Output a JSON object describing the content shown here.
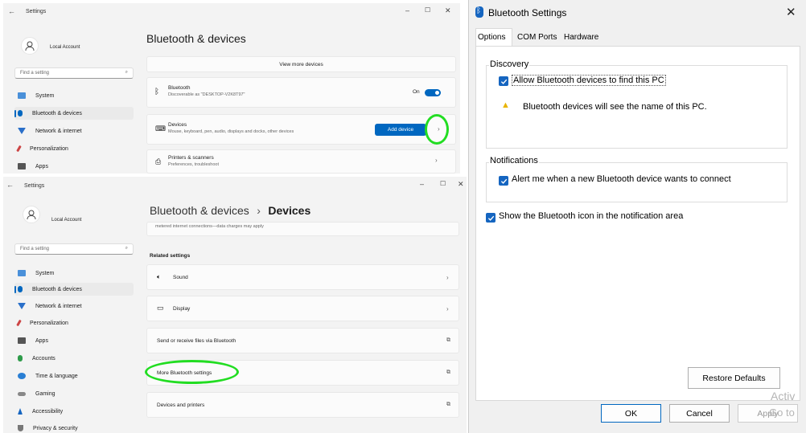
{
  "w1": {
    "title": "Settings",
    "account": "Local Account",
    "search_placeholder": "Find a setting",
    "nav": [
      "System",
      "Bluetooth & devices",
      "Network & internet",
      "Personalization",
      "Apps"
    ],
    "heading": "Bluetooth & devices",
    "view_more": "View more devices",
    "bluetooth": {
      "title": "Bluetooth",
      "sub": "Discoverable as \"DESKTOP-V2K8T97\"",
      "state": "On"
    },
    "devices": {
      "title": "Devices",
      "sub": "Mouse, keyboard, pen, audio, displays and docks, other devices",
      "button": "Add device"
    },
    "printers": {
      "title": "Printers & scanners",
      "sub": "Preferences, troubleshoot"
    }
  },
  "w2": {
    "title": "Settings",
    "account": "Local Account",
    "search_placeholder": "Find a setting",
    "nav": [
      "System",
      "Bluetooth & devices",
      "Network & internet",
      "Personalization",
      "Apps",
      "Accounts",
      "Time & language",
      "Gaming",
      "Accessibility",
      "Privacy & security"
    ],
    "breadcrumb_parent": "Bluetooth & devices",
    "breadcrumb_sep": "›",
    "breadcrumb_current": "Devices",
    "metered_text": "metered internet connections—data charges may apply",
    "related_header": "Related settings",
    "rows": [
      "Sound",
      "Display",
      "Send or receive files via Bluetooth",
      "More Bluetooth settings",
      "Devices and printers"
    ]
  },
  "dialog": {
    "title": "Bluetooth Settings",
    "tabs": [
      "Options",
      "COM Ports",
      "Hardware"
    ],
    "discovery_label": "Discovery",
    "allow_label": "Allow Bluetooth devices to find this PC",
    "warning_text": "Bluetooth devices will see the name of this PC.",
    "notifications_label": "Notifications",
    "alert_label": "Alert me when a new Bluetooth device wants to connect",
    "show_icon_label": "Show the Bluetooth icon in the notification area",
    "restore_button": "Restore Defaults",
    "ok_button": "OK",
    "cancel_button": "Cancel",
    "apply_button": "Apply",
    "watermark_1": "Activ",
    "watermark_2": "Go to"
  },
  "colors": {
    "accent": "#0067c0",
    "highlight": "#22dd22"
  }
}
